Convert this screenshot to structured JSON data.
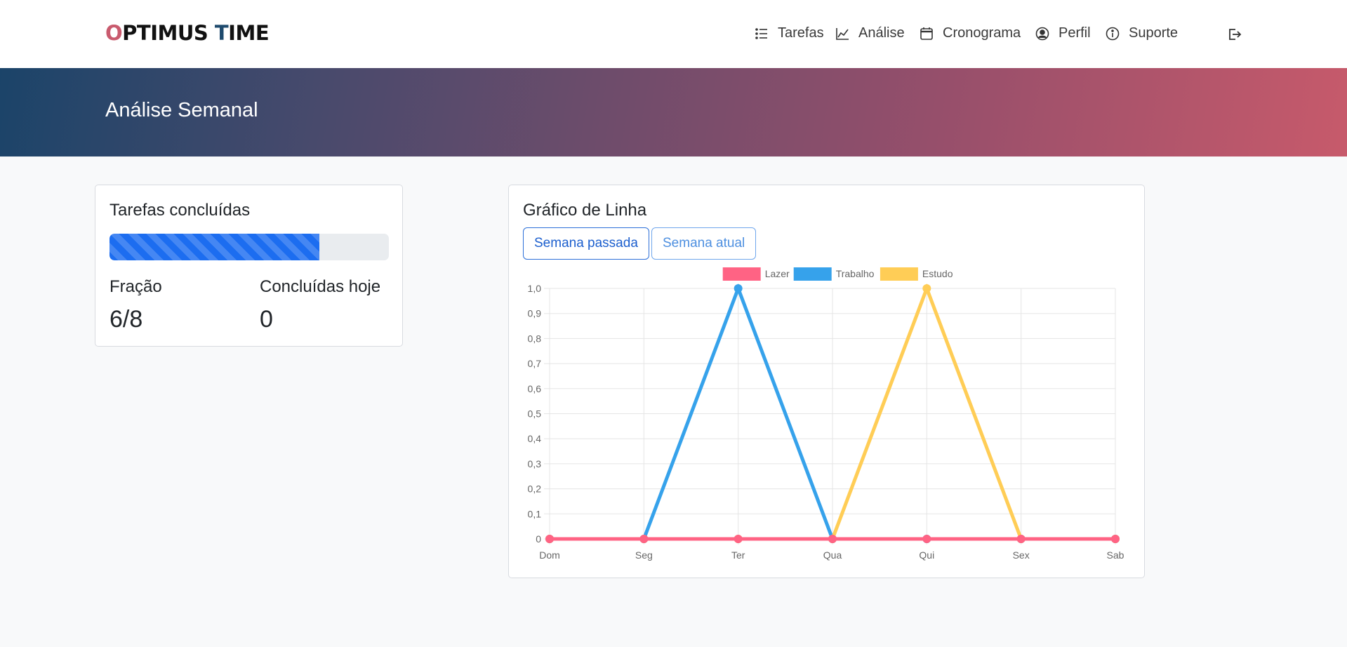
{
  "brand": {
    "first_o": "O",
    "part1": "PTIMUS ",
    "t": "T",
    "part2": "IME"
  },
  "nav": {
    "items": [
      {
        "label": "Tarefas",
        "icon": "list-icon"
      },
      {
        "label": "Análise",
        "icon": "graph-icon"
      },
      {
        "label": "Cronograma",
        "icon": "calendar-icon"
      },
      {
        "label": "Perfil",
        "icon": "user-circle-icon"
      },
      {
        "label": "Suporte",
        "icon": "info-icon"
      }
    ],
    "logout_icon": "logout-icon"
  },
  "hero": {
    "title": "Análise Semanal"
  },
  "progress_card": {
    "title": "Tarefas concluídas",
    "progress": 0.75,
    "fraction_label": "Fração",
    "fraction_value": "6/8",
    "today_label": "Concluídas hoje",
    "today_value": "0"
  },
  "chart_card": {
    "title": "Gráfico de Linha",
    "buttons": {
      "last_week": "Semana passada",
      "this_week": "Semana atual"
    }
  },
  "colors": {
    "brand_red": "#c95b6e",
    "brand_blue": "#1e4a6d",
    "progress": "#1c6df0",
    "lazer": "#ff6384",
    "trabalho": "#36a2eb",
    "estudo": "#ffcd56"
  },
  "chart_data": {
    "type": "line",
    "x": [
      "Dom",
      "Seg",
      "Ter",
      "Qua",
      "Qui",
      "Sex",
      "Sab"
    ],
    "ylim": [
      0,
      1
    ],
    "yticks": [
      "0",
      "0,1",
      "0,2",
      "0,3",
      "0,4",
      "0,5",
      "0,6",
      "0,7",
      "0,8",
      "0,9",
      "1,0"
    ],
    "legend": "top",
    "grid": true,
    "series": [
      {
        "name": "Trabalho",
        "color": "#36a2eb",
        "values": [
          0,
          0,
          1,
          0,
          0,
          0,
          0
        ]
      },
      {
        "name": "Estudo",
        "color": "#ffcd56",
        "values": [
          0,
          0,
          0,
          0,
          1,
          0,
          0
        ]
      },
      {
        "name": "Lazer",
        "color": "#ff6384",
        "values": [
          0,
          0,
          0,
          0,
          0,
          0,
          0
        ]
      }
    ],
    "legend_order": [
      "Lazer",
      "Trabalho",
      "Estudo"
    ]
  }
}
